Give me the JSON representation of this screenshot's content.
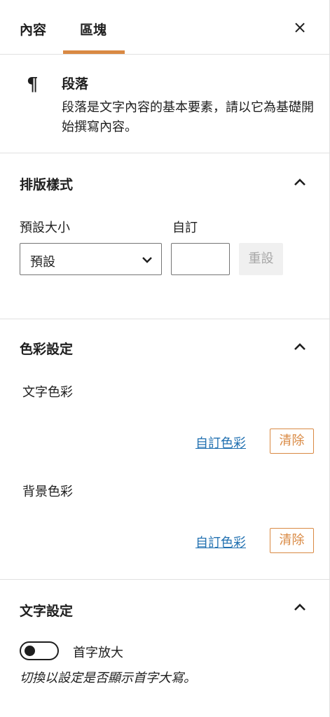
{
  "tabs": {
    "content": "內容",
    "block": "區塊",
    "close": "×"
  },
  "block": {
    "icon": "¶",
    "title": "段落",
    "description": "段落是文字內容的基本要素，請以它為基礎開始撰寫內容。"
  },
  "typography": {
    "title": "排版樣式",
    "preset_label": "預設大小",
    "custom_label": "自訂",
    "select_value": "預設",
    "custom_value": "",
    "reset_label": "重設"
  },
  "color": {
    "title": "色彩設定",
    "text_color_label": "文字色彩",
    "background_color_label": "背景色彩",
    "custom_color_link": "自訂色彩",
    "clear_label": "清除"
  },
  "text_settings": {
    "title": "文字設定",
    "dropcap_label": "首字放大",
    "dropcap_help": "切換以設定是否顯示首字大寫。",
    "dropcap_enabled": false
  },
  "colors": {
    "accent": "#d98943",
    "link": "#2271b1",
    "border": "#e0e0e0"
  }
}
